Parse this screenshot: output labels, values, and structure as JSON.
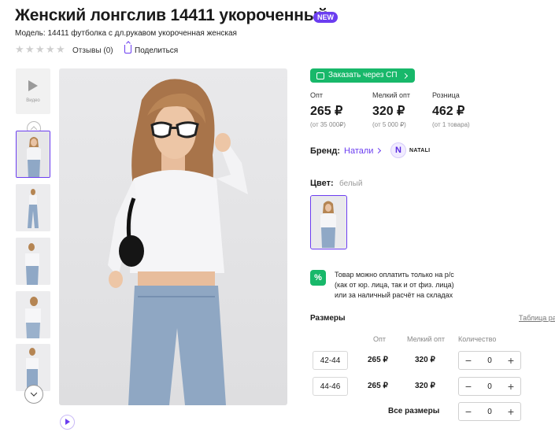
{
  "product": {
    "title": "Женский лонгслив 14411 укороченный",
    "badge": "NEW",
    "model": "Модель: 14411 футболка с дл.рукавом укороченная женская",
    "reviews": "Отзывы (0)",
    "share": "Поделиться"
  },
  "gallery": {
    "video_label": "Видео",
    "thumbnails": [
      "photo-1",
      "photo-2",
      "photo-3",
      "photo-4",
      "photo-5"
    ]
  },
  "order": {
    "sp_button": "Заказать через СП"
  },
  "prices": [
    {
      "label": "Опт",
      "value": "265 ₽",
      "note": "(от 35 000₽)"
    },
    {
      "label": "Мелкий опт",
      "value": "320 ₽",
      "note": "(от 5 000 ₽)"
    },
    {
      "label": "Розница",
      "value": "462 ₽",
      "note": "(от 1 товара)"
    }
  ],
  "brand": {
    "label": "Бренд:",
    "value": "Натали",
    "logo_letter": "N",
    "logo_text": "NATALI"
  },
  "color": {
    "label": "Цвет:",
    "value": "белый"
  },
  "payment_note": {
    "icon": "%",
    "lines": [
      "Товар можно оплатить только на р/с",
      "(как от юр. лица, так и от физ. лица)",
      "или за наличный расчёт на складах"
    ]
  },
  "sizes": {
    "title": "Размеры",
    "table_link": "Таблица ра",
    "headers": {
      "opt": "Опт",
      "small_opt": "Мелкий опт",
      "qty": "Количество"
    },
    "rows": [
      {
        "size": "42-44",
        "opt": "265 ₽",
        "small_opt": "320 ₽",
        "qty": "0"
      },
      {
        "size": "44-46",
        "opt": "265 ₽",
        "small_opt": "320 ₽",
        "qty": "0"
      }
    ],
    "all_label": "Все размеры",
    "all_qty": "0",
    "minus": "−",
    "plus": "+"
  },
  "colors": {
    "accent": "#6b3df0",
    "green": "#18b86a"
  }
}
